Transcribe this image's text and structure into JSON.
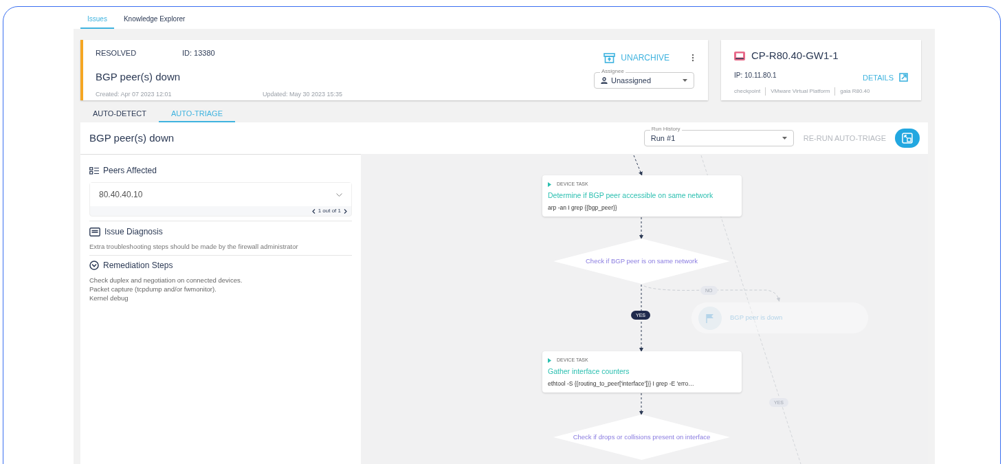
{
  "top_tabs": [
    {
      "label": "Issues",
      "selected": true
    },
    {
      "label": "Knowledge Explorer",
      "selected": false
    }
  ],
  "issue": {
    "status": "RESOLVED",
    "id": "ID: 13380",
    "title": "BGP peer(s) down",
    "created": "Created: Apr 07 2023 12:01",
    "updated": "Updated: May 30 2023 15:35",
    "unarchive": "UNARCHIVE",
    "assignee": {
      "label": "Assignee",
      "value": "Unassigned"
    }
  },
  "device": {
    "name": "CP-R80.40-GW1-1",
    "ip": "IP: 10.11.80.1",
    "details": "DETAILS",
    "tags": [
      "checkpoint",
      "VMware Virtual Platform",
      "gaia R80.40"
    ]
  },
  "triage_tabs": [
    {
      "label": "AUTO-DETECT",
      "selected": false
    },
    {
      "label": "AUTO-TRIAGE",
      "selected": true
    }
  ],
  "panel": {
    "title": "BGP peer(s) down",
    "run_history": {
      "label": "Run History",
      "value": "Run #1"
    },
    "rerun": {
      "label": "RE-RUN AUTO-TRIAGE",
      "disabled": true
    }
  },
  "peers": {
    "title": "Peers Affected",
    "value": "80.40.40.10",
    "pager": "1 out of 1"
  },
  "diagnosis": {
    "title": "Issue Diagnosis",
    "text": "Extra troubleshooting steps should be made by the firewall administrator"
  },
  "remediation": {
    "title": "Remediation Steps",
    "lines": [
      "Check duplex and negotiation on connected devices.",
      "Packet capture (tcpdump and/or fwmonitor).",
      "Kernel debug"
    ]
  },
  "flow": {
    "nodes": [
      {
        "kind": "task",
        "tag": "DEVICE TASK",
        "title": "Determine if BGP peer accessible on same network",
        "command": "arp -an I grep {{bgp_peer}}",
        "dimmed": false
      },
      {
        "kind": "decision",
        "title": "Check if BGP peer is on same network",
        "dimmed": false
      },
      {
        "kind": "end",
        "title": "BGP peer is down",
        "dimmed": true
      },
      {
        "kind": "task",
        "tag": "DEVICE TASK",
        "title": "Gather interface counters",
        "command": "ethtool -S {{routing_to_peer['interface']}} I grep -E 'erro…",
        "dimmed": false
      },
      {
        "kind": "decision",
        "title": "Check if drops or collisions present on interface",
        "dimmed": false
      }
    ],
    "edge_labels": [
      {
        "text": "NO",
        "dimmed": true
      },
      {
        "text": "YES",
        "dimmed": false
      },
      {
        "text": "YES",
        "dimmed": true
      }
    ]
  }
}
